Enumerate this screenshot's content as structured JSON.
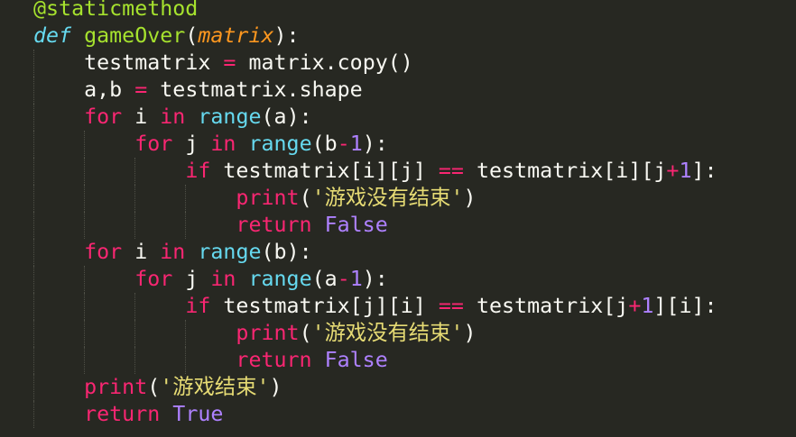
{
  "code": {
    "decorator": "@staticmethod",
    "def_kw": "def",
    "func_name": "gameOver",
    "param": "matrix",
    "copy_target": "testmatrix",
    "copy_expr": "matrix.copy()",
    "shape_target": "a,b",
    "shape_expr": "testmatrix.shape",
    "kw_for": "for",
    "kw_in": "in",
    "kw_if": "if",
    "kw_return": "return",
    "builtin_range": "range",
    "builtin_print": "print",
    "var_i": "i",
    "var_j": "j",
    "var_a": "a",
    "var_b": "b",
    "op_eq": "==",
    "op_minus": "-",
    "op_plus": "+",
    "num_one": "1",
    "const_false": "False",
    "const_true": "True",
    "str_not_over": "'游戏没有结束'",
    "str_over": "'游戏结束'",
    "tm": "testmatrix"
  },
  "colors": {
    "background": "#272822",
    "foreground": "#f8f8f2",
    "keyword": "#f92672",
    "function": "#a6e22e",
    "builtin": "#66d9ef",
    "constant": "#ae81ff",
    "string": "#e6db74",
    "parameter": "#fd971f"
  }
}
